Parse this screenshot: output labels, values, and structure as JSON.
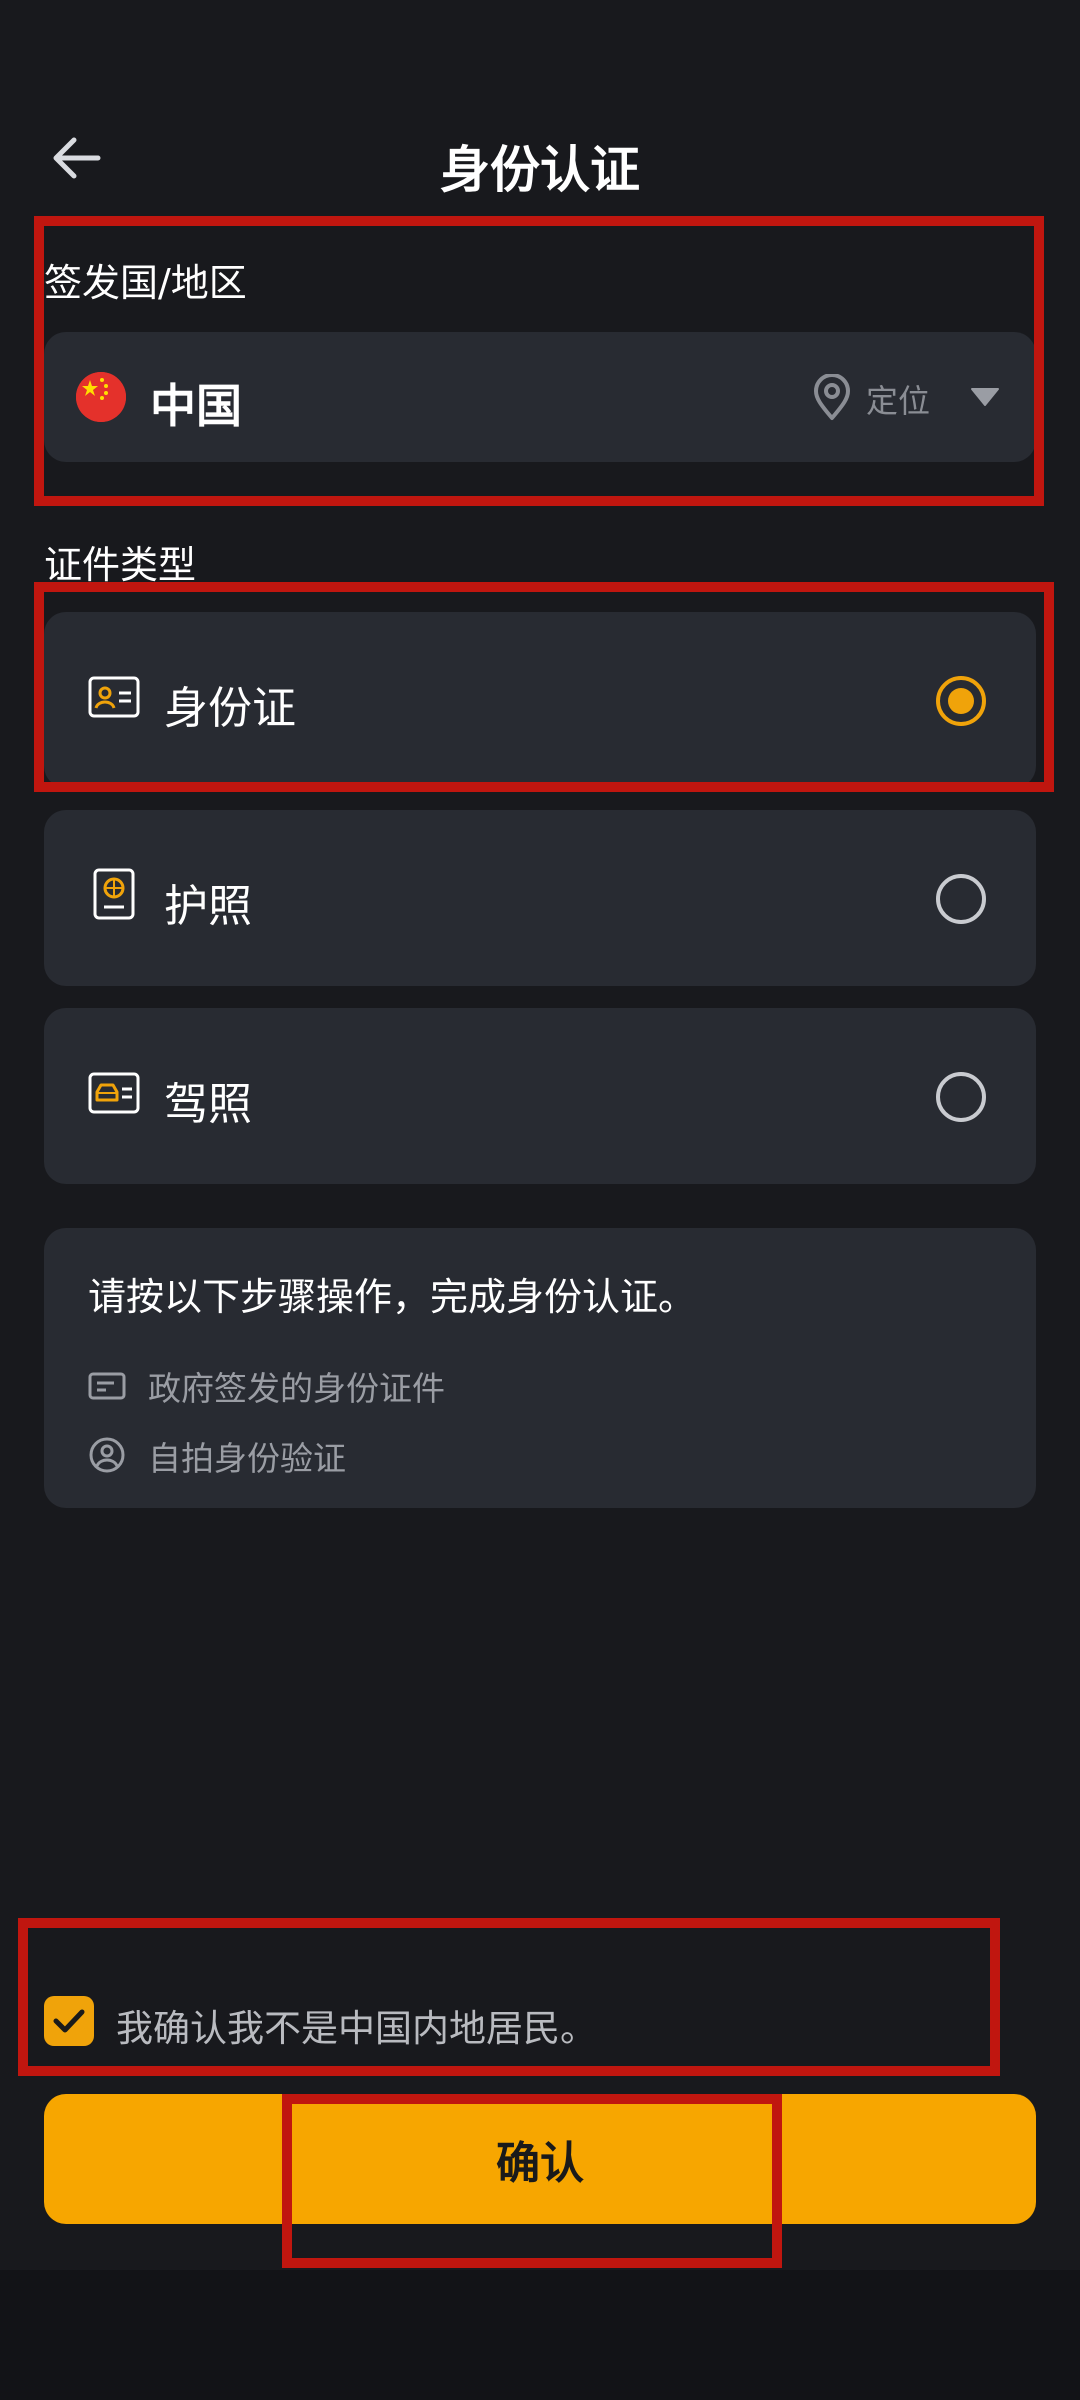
{
  "header": {
    "back_icon": "arrow-left-icon",
    "title": "身份认证"
  },
  "country": {
    "section_label": "签发国/地区",
    "flag_icon": "china-flag-icon",
    "name": "中国",
    "locate_icon": "location-pin-icon",
    "locate_label": "定位",
    "dropdown_icon": "triangle-down-icon"
  },
  "doc_type": {
    "section_label": "证件类型",
    "options": [
      {
        "icon": "id-card-icon",
        "label": "身份证",
        "selected": true
      },
      {
        "icon": "passport-icon",
        "label": "护照",
        "selected": false
      },
      {
        "icon": "driver-license-icon",
        "label": "驾照",
        "selected": false
      }
    ]
  },
  "info": {
    "title": "请按以下步骤操作，完成身份认证。",
    "steps": [
      {
        "icon": "document-card-icon",
        "text": "政府签发的身份证件"
      },
      {
        "icon": "user-circle-icon",
        "text": "自拍身份验证"
      }
    ]
  },
  "confirm_check": {
    "checked": true,
    "label": "我确认我不是中国内地居民。"
  },
  "confirm_button": {
    "label": "确认"
  },
  "colors": {
    "background": "#18191d",
    "card": "#282b32",
    "accent": "#f7a600",
    "highlight_border": "#c0160f"
  }
}
